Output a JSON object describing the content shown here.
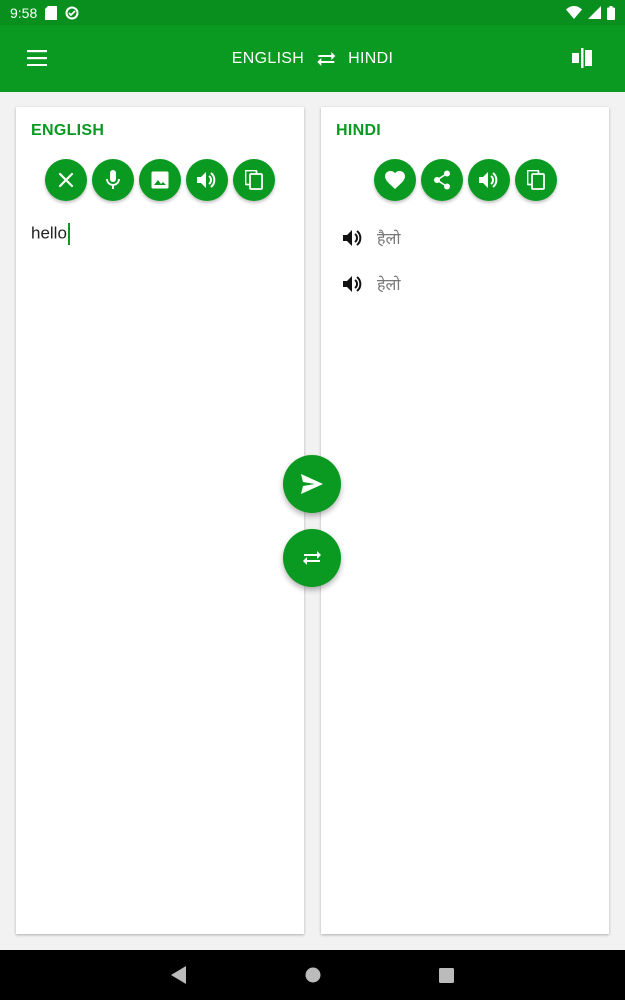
{
  "status_bar": {
    "time": "9:58",
    "icons": [
      "sd-card-icon",
      "data-saver-icon",
      "wifi-icon",
      "signal-icon",
      "battery-icon"
    ]
  },
  "app_bar": {
    "menu_icon": "hamburger-menu-icon",
    "source_language": "ENGLISH",
    "target_language": "HINDI",
    "swap_icon": "swap-arrows-icon",
    "right_icon": "split-view-icon"
  },
  "source_panel": {
    "title": "ENGLISH",
    "actions": [
      "clear-icon",
      "mic-icon",
      "image-icon",
      "speaker-icon",
      "copy-icon"
    ],
    "input_value": "hello"
  },
  "target_panel": {
    "title": "HINDI",
    "actions": [
      "favorite-icon",
      "share-icon",
      "speaker-icon",
      "copy-icon"
    ],
    "results": [
      {
        "text": "हैलो"
      },
      {
        "text": "हेलो"
      }
    ]
  },
  "fabs": {
    "translate_icon": "send-icon",
    "swap_icon": "swap-arrows-icon"
  },
  "nav_bar": {
    "icons": [
      "back-icon",
      "home-icon",
      "recents-icon"
    ]
  },
  "colors": {
    "primary": "#0a9a22",
    "status_bar": "#088f1e",
    "background": "#f2f2f2",
    "result_text": "#777777"
  }
}
